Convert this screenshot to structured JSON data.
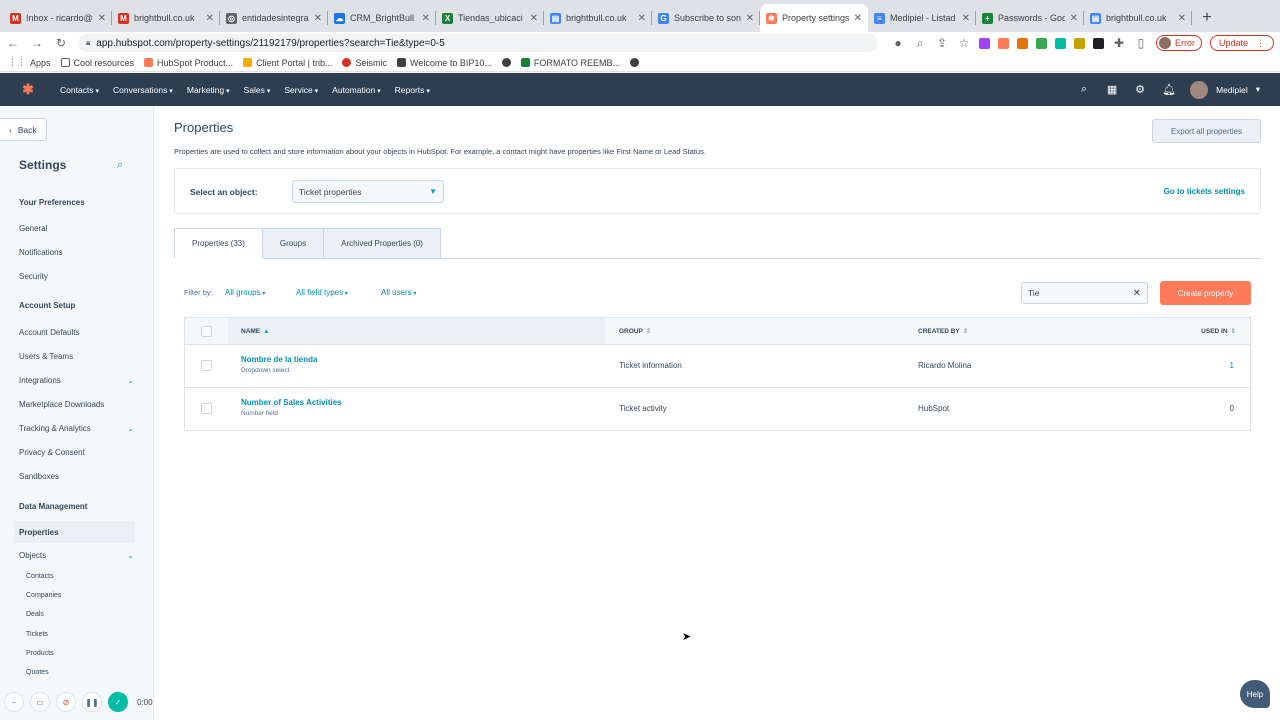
{
  "browser": {
    "tabs": [
      {
        "title": "Inbox - ricardo@b",
        "icon": "gmail-icon",
        "color": "#d93025",
        "glyph": "M"
      },
      {
        "title": "brightbull.co.uk",
        "icon": "gmail-icon",
        "color": "#d93025",
        "glyph": "M"
      },
      {
        "title": "entidadesintegra",
        "icon": "globe-icon",
        "color": "#5f6368",
        "glyph": "◎"
      },
      {
        "title": "CRM_BrightBull",
        "icon": "cloud-icon",
        "color": "#1a73e8",
        "glyph": "☁"
      },
      {
        "title": "Tiendas_ubicaci",
        "icon": "excel-icon",
        "color": "#188038",
        "glyph": "X"
      },
      {
        "title": "brightbull.co.uk",
        "icon": "doc-icon",
        "color": "#4285f4",
        "glyph": "▤"
      },
      {
        "title": "Subscribe to son",
        "icon": "google-icon",
        "color": "#4285f4",
        "glyph": "G"
      },
      {
        "title": "Property settings",
        "icon": "hubspot-icon",
        "color": "#ff7a59",
        "glyph": "✱",
        "active": true
      },
      {
        "title": "Medipiel - Listad",
        "icon": "doc-icon",
        "color": "#4285f4",
        "glyph": "≡"
      },
      {
        "title": "Passwords - Goo",
        "icon": "sheets-icon",
        "color": "#188038",
        "glyph": "+"
      },
      {
        "title": "brightbull.co.uk",
        "icon": "doc-icon",
        "color": "#4285f4",
        "glyph": "▤"
      }
    ],
    "url": "app.hubspot.com/property-settings/21192179/properties?search=Tie&type=0-5",
    "error_label": "Error",
    "update_label": "Update",
    "bookmarks": [
      {
        "label": "Apps",
        "color": "#5f6368"
      },
      {
        "label": "Cool resources",
        "color": "#5f6368"
      },
      {
        "label": "HubSpot Product...",
        "color": "#ff7a59"
      },
      {
        "label": "Client Portal | trib...",
        "color": "#f9ab00"
      },
      {
        "label": "Seismic",
        "color": "#d93025"
      },
      {
        "label": "Welcome to BIP10...",
        "color": "#3c4043"
      },
      {
        "label": "",
        "color": "#3c4043"
      },
      {
        "label": "FORMATO REEMB...",
        "color": "#188038"
      },
      {
        "label": "",
        "color": "#3c4043"
      }
    ]
  },
  "topnav": {
    "items": [
      "Contacts",
      "Conversations",
      "Marketing",
      "Sales",
      "Service",
      "Automation",
      "Reports"
    ],
    "account": "Medipiel"
  },
  "sidebar": {
    "back": "Back",
    "title": "Settings",
    "sections": [
      {
        "heading": "Your Preferences",
        "items": [
          "General",
          "Notifications",
          "Security"
        ]
      },
      {
        "heading": "Account Setup",
        "items": [
          "Account Defaults",
          "Users & Teams",
          "Integrations",
          "Marketplace Downloads",
          "Tracking & Analytics",
          "Privacy & Consent",
          "Sandboxes"
        ]
      },
      {
        "heading": "Data Management",
        "items": [
          "Properties",
          "Objects"
        ]
      }
    ],
    "object_subitems": [
      "Contacts",
      "Companies",
      "Deals",
      "Tickets",
      "Products",
      "Quotes"
    ]
  },
  "main": {
    "title": "Properties",
    "description": "Properties are used to collect and store information about your objects in HubSpot. For example, a contact might have properties like First Name or Lead Status.",
    "export_button": "Export all properties",
    "select_label": "Select an object:",
    "selected_object": "Ticket properties",
    "goto_link": "Go to tickets settings",
    "tabs": [
      "Properties (33)",
      "Groups",
      "Archived Properties (0)"
    ],
    "filter_label": "Filter by:",
    "filters": [
      "All groups",
      "All field types",
      "All users"
    ],
    "search_value": "Tie",
    "create_button": "Create property",
    "columns": [
      "NAME",
      "GROUP",
      "CREATED BY",
      "USED IN"
    ],
    "rows": [
      {
        "name": "Nombre de la tienda",
        "type": "Dropdown select",
        "group": "Ticket information",
        "created_by": "Ricardo Molina",
        "used_in": "1"
      },
      {
        "name": "Number of Sales Activities",
        "type": "Number field",
        "group": "Ticket activity",
        "created_by": "HubSpot",
        "used_in": "0"
      }
    ]
  },
  "recorder": {
    "time": "0:00"
  },
  "help_label": "Help"
}
